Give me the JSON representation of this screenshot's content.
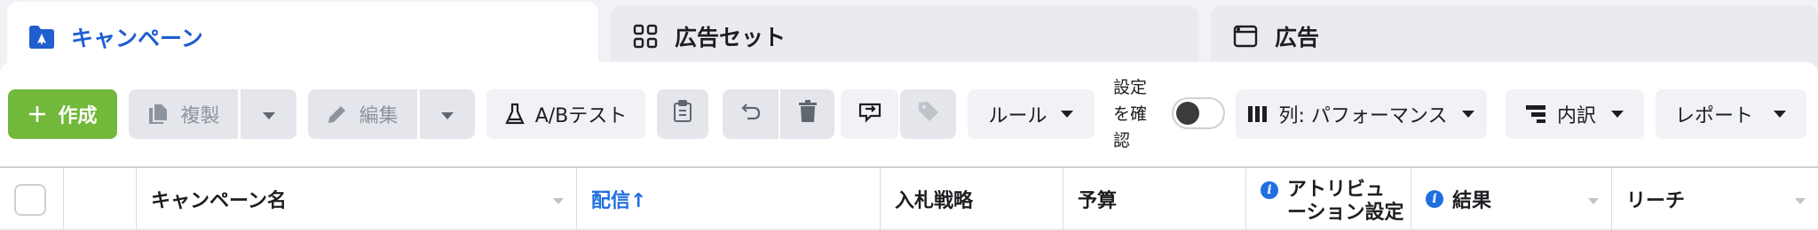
{
  "tabs": [
    {
      "label": "キャンペーン",
      "icon": "campaign-folder-icon",
      "active": true
    },
    {
      "label": "広告セット",
      "icon": "grid-icon",
      "active": false
    },
    {
      "label": "広告",
      "icon": "ad-window-icon",
      "active": false
    }
  ],
  "toolbar": {
    "create_label": "作成",
    "duplicate_label": "複製",
    "edit_label": "編集",
    "ab_test_label": "A/Bテスト",
    "rules_label": "ルール",
    "settings_label": "設定を確認",
    "columns_label": "列: パフォーマンス",
    "breakdown_label": "内訳",
    "report_label": "レポート"
  },
  "table": {
    "columns": [
      {
        "label": "キャンペーン名"
      },
      {
        "label": "配信↑"
      },
      {
        "label": "入札戦略"
      },
      {
        "label": "予算"
      },
      {
        "label": "アトリビューション設定"
      },
      {
        "label": "結果"
      },
      {
        "label": "リーチ"
      }
    ]
  },
  "colors": {
    "accent": "#1f5fcf",
    "create": "#72b83a",
    "link": "#1f6fe0"
  }
}
